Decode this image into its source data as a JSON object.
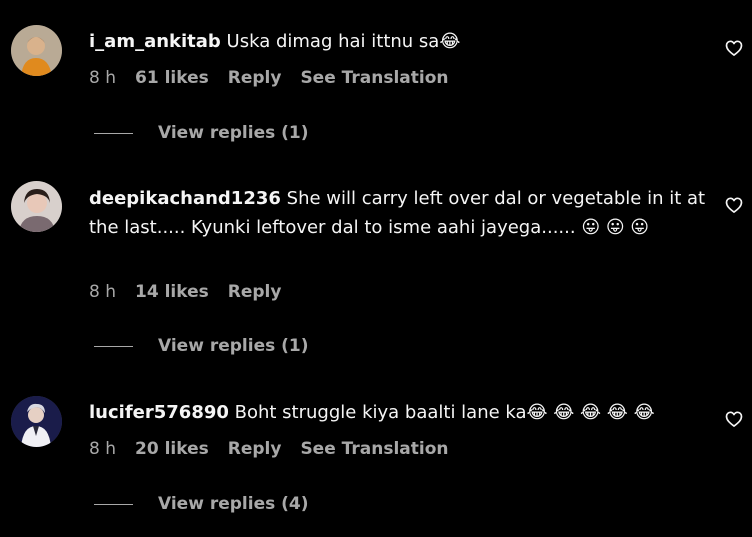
{
  "comments": [
    {
      "username": "i_am_ankitab",
      "text": "Uska dimag hai ittnu sa",
      "emojis": "😂",
      "time": "8 h",
      "likes": "61 likes",
      "reply_label": "Reply",
      "translate_label": "See Translation",
      "view_replies": "View replies (1)"
    },
    {
      "username": "deepikachand1236",
      "text": "She will carry left over dal or vegetable in it at the last..... Kyunki leftover dal to isme aahi jayega......",
      "emojis": " 😛 😛 😛",
      "time": "8 h",
      "likes": "14 likes",
      "reply_label": "Reply",
      "view_replies": "View replies (1)"
    },
    {
      "username": "lucifer576890",
      "text": "Boht struggle kiya baalti lane ka",
      "emojis": "😂 😂 😂 😂 😂",
      "time": "8 h",
      "likes": "20 likes",
      "reply_label": "Reply",
      "translate_label": "See Translation",
      "view_replies": "View replies (4)"
    }
  ],
  "icons": {
    "like": "heart-outline-icon"
  },
  "colors": {
    "background": "#000000",
    "primary_text": "#f5f5f5",
    "secondary_text": "#a8a8a8"
  }
}
